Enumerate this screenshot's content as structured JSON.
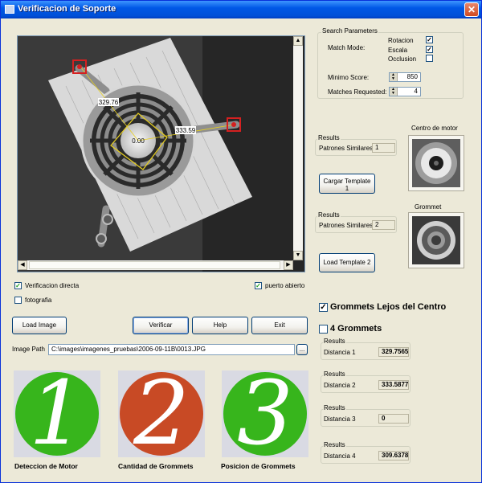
{
  "window": {
    "title": "Verificacion de Soporte",
    "close_glyph": "✕"
  },
  "viewer": {
    "overlays": {
      "center_score": "0.00",
      "left_distance": "329.76",
      "right_distance": "333.59"
    }
  },
  "options": {
    "verificacion_directa": {
      "label": "Verificacion directa",
      "checked": true
    },
    "fotografia": {
      "label": "fotografia",
      "checked": false
    },
    "puerto_abierto": {
      "label": "puerto abierto",
      "checked": true
    }
  },
  "buttons": {
    "load_image": "Load Image",
    "verificar": "Verificar",
    "help": "Help",
    "exit": "Exit",
    "cargar_template_1_line1": "Cargar Template",
    "cargar_template_1_line2": "1",
    "load_template_2": "Load Template 2",
    "browse": "..."
  },
  "image_path": {
    "label": "Image Path",
    "value": "C:\\images\\imagenes_pruebas\\2006-09-11B\\0013.JPG"
  },
  "search_parameters": {
    "title": "Search Parameters",
    "match_mode_label": "Match Mode:",
    "rotacion": {
      "label": "Rotacion",
      "checked": true
    },
    "escala": {
      "label": "Escala",
      "checked": true
    },
    "occlusion": {
      "label": "Occlusion",
      "checked": false
    },
    "minimo_score_label": "Minimo Score:",
    "minimo_score_value": "850",
    "matches_requested_label": "Matches Requested:",
    "matches_requested_value": "4"
  },
  "template1": {
    "results_label": "Results",
    "patrones_label": "Patrones Similares:",
    "patrones_value": "1",
    "preview_title": "Centro de motor"
  },
  "template2": {
    "results_label": "Results",
    "patrones_label": "Patrones Similares:",
    "patrones_value": "2",
    "preview_title": "Grommet"
  },
  "checks": {
    "grommets_lejos": {
      "label": "Grommets Lejos del Centro",
      "checked": true
    },
    "cuatro_grommets": {
      "label": "4 Grommets",
      "checked": false
    }
  },
  "distances": [
    {
      "results_label": "Results",
      "label": "Distancia 1",
      "value": "329.7565"
    },
    {
      "results_label": "Results",
      "label": "Distancia 2",
      "value": "333.5877"
    },
    {
      "results_label": "Results",
      "label": "Distancia 3",
      "value": "0"
    },
    {
      "results_label": "Results",
      "label": "Distancia 4",
      "value": "309.6378"
    }
  ],
  "steps": [
    {
      "digit": "1",
      "caption": "Deteccion de Motor",
      "color": "#37b51c"
    },
    {
      "digit": "2",
      "caption": "Cantidad de Grommets",
      "color": "#c84a25"
    },
    {
      "digit": "3",
      "caption": "Posicion de Grommets",
      "color": "#37b51c"
    }
  ],
  "colors": {
    "title_bar": "#0058e6",
    "window_bg": "#ece9d8",
    "check_mark": "#21a121",
    "overlay_marker": "#d42020",
    "overlay_match": "#e8d020"
  }
}
